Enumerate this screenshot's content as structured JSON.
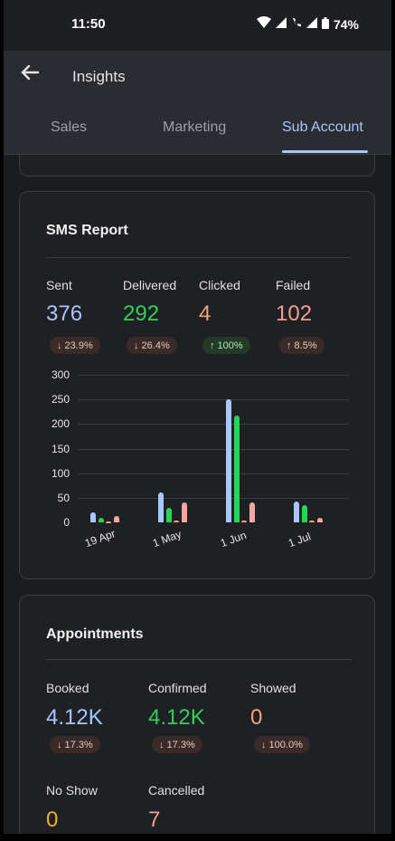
{
  "status": {
    "time": "11:50",
    "battery": "74%"
  },
  "appbar": {
    "title": "Insights"
  },
  "tabs": [
    {
      "label": "Sales"
    },
    {
      "label": "Marketing"
    },
    {
      "label": "Sub Account"
    }
  ],
  "sms": {
    "title": "SMS Report",
    "stats": [
      {
        "label": "Sent",
        "value": "376",
        "change": "↓ 23.9%",
        "color": "#a9c6ff"
      },
      {
        "label": "Delivered",
        "value": "292",
        "change": "↓ 26.4%",
        "color": "#2ed158"
      },
      {
        "label": "Clicked",
        "value": "4",
        "change": "↑ 100%",
        "color": "#f0a37d"
      },
      {
        "label": "Failed",
        "value": "102",
        "change": "↑ 8.5%",
        "color": "#f39b94"
      }
    ]
  },
  "chart_data": {
    "type": "bar",
    "categories": [
      "19 Apr",
      "1 May",
      "1 Jun",
      "1 Jul"
    ],
    "series": [
      {
        "name": "Sent",
        "values": [
          20,
          60,
          250,
          43
        ],
        "color": "#a9c6ff"
      },
      {
        "name": "Delivered",
        "values": [
          10,
          30,
          217,
          35
        ],
        "color": "#2ed158"
      },
      {
        "name": "Clicked",
        "values": [
          1,
          3,
          3,
          3
        ],
        "color": "#f0a37d"
      },
      {
        "name": "Failed",
        "values": [
          12,
          40,
          40,
          10
        ],
        "color": "#f3a7a0"
      }
    ],
    "yticks": [
      "300",
      "250",
      "200",
      "150",
      "100",
      "50",
      "0"
    ],
    "ylim": [
      0,
      300
    ]
  },
  "appointments": {
    "title": "Appointments",
    "stats": [
      {
        "label": "Booked",
        "value": "4.12K",
        "change": "↓ 17.3%",
        "color": "#a9c6ff"
      },
      {
        "label": "Confirmed",
        "value": "4.12K",
        "change": "↓ 17.3%",
        "color": "#2ed158"
      },
      {
        "label": "Showed",
        "value": "0",
        "change": "↓ 100.0%",
        "color": "#f0a37d"
      },
      {
        "label": "No Show",
        "value": "0",
        "color": "#f2b01e"
      },
      {
        "label": "Cancelled",
        "value": "7",
        "color": "#f39b94"
      }
    ]
  }
}
